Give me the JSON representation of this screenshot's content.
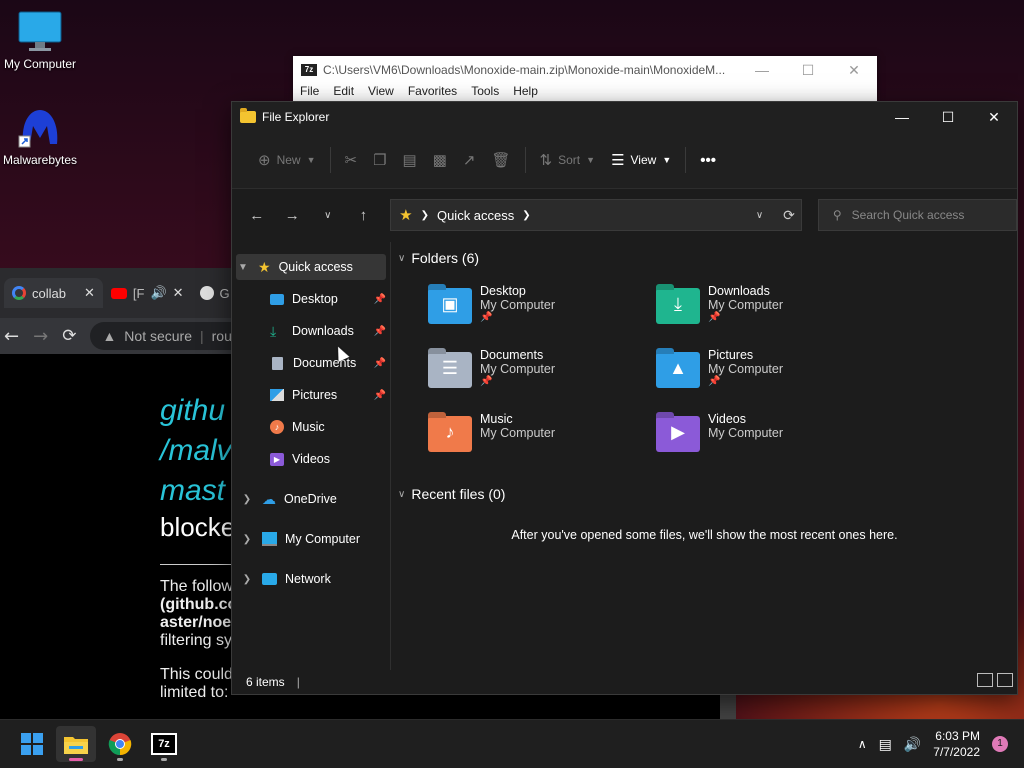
{
  "desktop": {
    "icons": [
      {
        "label": "My Computer",
        "icon": "monitor-icon"
      },
      {
        "label": "Malwarebytes",
        "icon": "malwarebytes-icon"
      }
    ]
  },
  "zip_window": {
    "title": "C:\\Users\\VM6\\Downloads\\Monoxide-main.zip\\Monoxide-main\\MonoxideM...",
    "app_icon_text": "7z",
    "menu": [
      "File",
      "Edit",
      "View",
      "Favorites",
      "Tools",
      "Help"
    ]
  },
  "chrome": {
    "tabs": [
      "collab",
      "[F",
      "G"
    ],
    "omnibox_security": "Not secure",
    "omnibox_text": "rou",
    "page": {
      "lines": [
        "githu",
        "/malv",
        "mast"
      ],
      "blocked": "blocke",
      "para1": [
        "The follow",
        "(github.co",
        "aster/noe",
        "filtering sy"
      ],
      "para2": [
        "This could",
        "limited to:"
      ]
    }
  },
  "explorer": {
    "title": "File Explorer",
    "commands": {
      "new": "New",
      "sort": "Sort",
      "view": "View"
    },
    "address": {
      "location": "Quick access"
    },
    "search_placeholder": "Search Quick access",
    "sidebar": {
      "quick_access": "Quick access",
      "pinned": [
        {
          "label": "Desktop",
          "pinned": true
        },
        {
          "label": "Downloads",
          "pinned": true
        },
        {
          "label": "Documents",
          "pinned": true
        },
        {
          "label": "Pictures",
          "pinned": true
        },
        {
          "label": "Music",
          "pinned": false
        },
        {
          "label": "Videos",
          "pinned": false
        }
      ],
      "onedrive": "OneDrive",
      "my_computer": "My Computer",
      "network": "Network"
    },
    "folders_header": "Folders (6)",
    "folders": [
      {
        "name": "Desktop",
        "location": "My Computer",
        "pinned": true,
        "color": "#2f9ee6"
      },
      {
        "name": "Downloads",
        "location": "My Computer",
        "pinned": true,
        "color": "#1fb58f"
      },
      {
        "name": "Documents",
        "location": "My Computer",
        "pinned": true,
        "color": "#a9b4c4"
      },
      {
        "name": "Pictures",
        "location": "My Computer",
        "pinned": true,
        "color": "#2f9ee6"
      },
      {
        "name": "Music",
        "location": "My Computer",
        "pinned": false,
        "color": "#f07a4a"
      },
      {
        "name": "Videos",
        "location": "My Computer",
        "pinned": false,
        "color": "#8b5ad8"
      }
    ],
    "recent_header": "Recent files (0)",
    "recent_empty": "After you've opened some files, we'll show the most recent ones here.",
    "status_items": "6 items"
  },
  "taskbar": {
    "apps": [
      "start-button",
      "file-explorer",
      "chrome",
      "7-zip"
    ],
    "time": "6:03 PM",
    "date": "7/7/2022",
    "notification_count": "1",
    "zip_icon_text": "7z"
  }
}
